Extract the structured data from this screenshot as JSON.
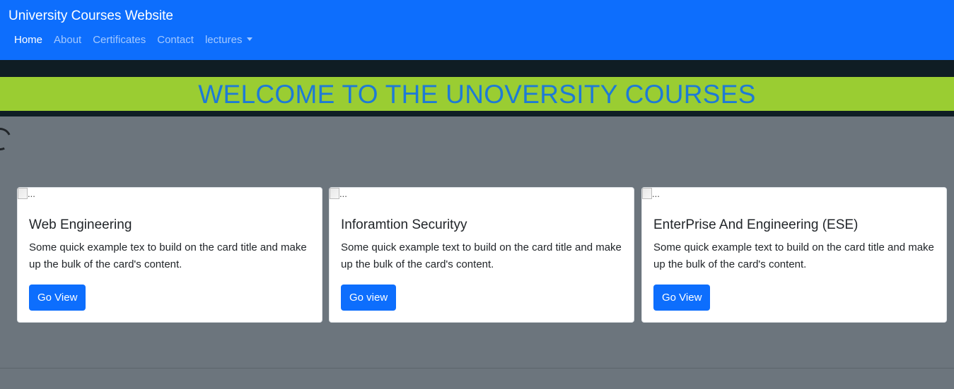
{
  "navbar": {
    "brand": "University Courses Website",
    "links": [
      {
        "label": "Home",
        "active": true
      },
      {
        "label": "About"
      },
      {
        "label": "Certificates"
      },
      {
        "label": "Contact"
      },
      {
        "label": "lectures",
        "dropdown": true
      }
    ]
  },
  "banner": {
    "title": "WELCOME TO THE UNOVERSITY COURSES"
  },
  "cards": [
    {
      "img_alt": "...",
      "title": "Web Engineering",
      "text": "Some quick example tex to build on the card title and make up the bulk of the card's content.",
      "button": "Go View"
    },
    {
      "img_alt": "...",
      "title": "Inforamtion Securityy",
      "text": "Some quick example text to build on the card title and make up the bulk of the card's content.",
      "button": "Go view"
    },
    {
      "img_alt": "...",
      "title": "EnterPrise And Engineering (ESE)",
      "text": "Some quick example text to build on the card title and make up the bulk of the card's content.",
      "button": "Go View"
    }
  ],
  "colors": {
    "navbar": "#0d6efd",
    "banner_bg": "#9acd32",
    "banner_text": "#1e7ad6",
    "page_bg": "#6c757d",
    "button": "#0d6efd"
  },
  "icons": {
    "spinner": "loading-spinner",
    "dropdown": "caret-down",
    "card_image": "broken-image"
  }
}
